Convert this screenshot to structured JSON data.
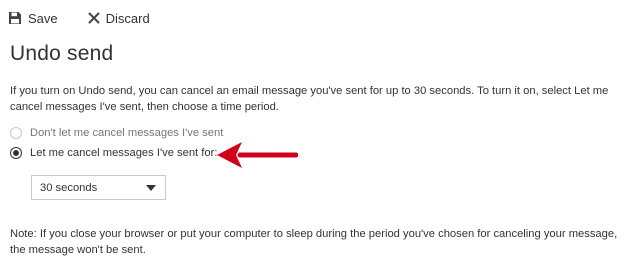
{
  "toolbar": {
    "save_label": "Save",
    "discard_label": "Discard"
  },
  "page": {
    "title": "Undo send",
    "description": "If you turn on Undo send, you can cancel an email message you've sent for up to 30 seconds. To turn it on, select Let me cancel messages I've sent, then choose a time period."
  },
  "options": [
    {
      "label": "Don't let me cancel messages I've sent",
      "selected": false
    },
    {
      "label": "Let me cancel messages I've sent for:",
      "selected": true
    }
  ],
  "time_period": {
    "selected": "30 seconds"
  },
  "note": "Note: If you close your browser or put your computer to sleep during the period you've chosen for canceling your message, the message won't be sent.",
  "colors": {
    "annotation_arrow": "#d0021b",
    "text": "#333333",
    "muted_text": "#767676"
  }
}
